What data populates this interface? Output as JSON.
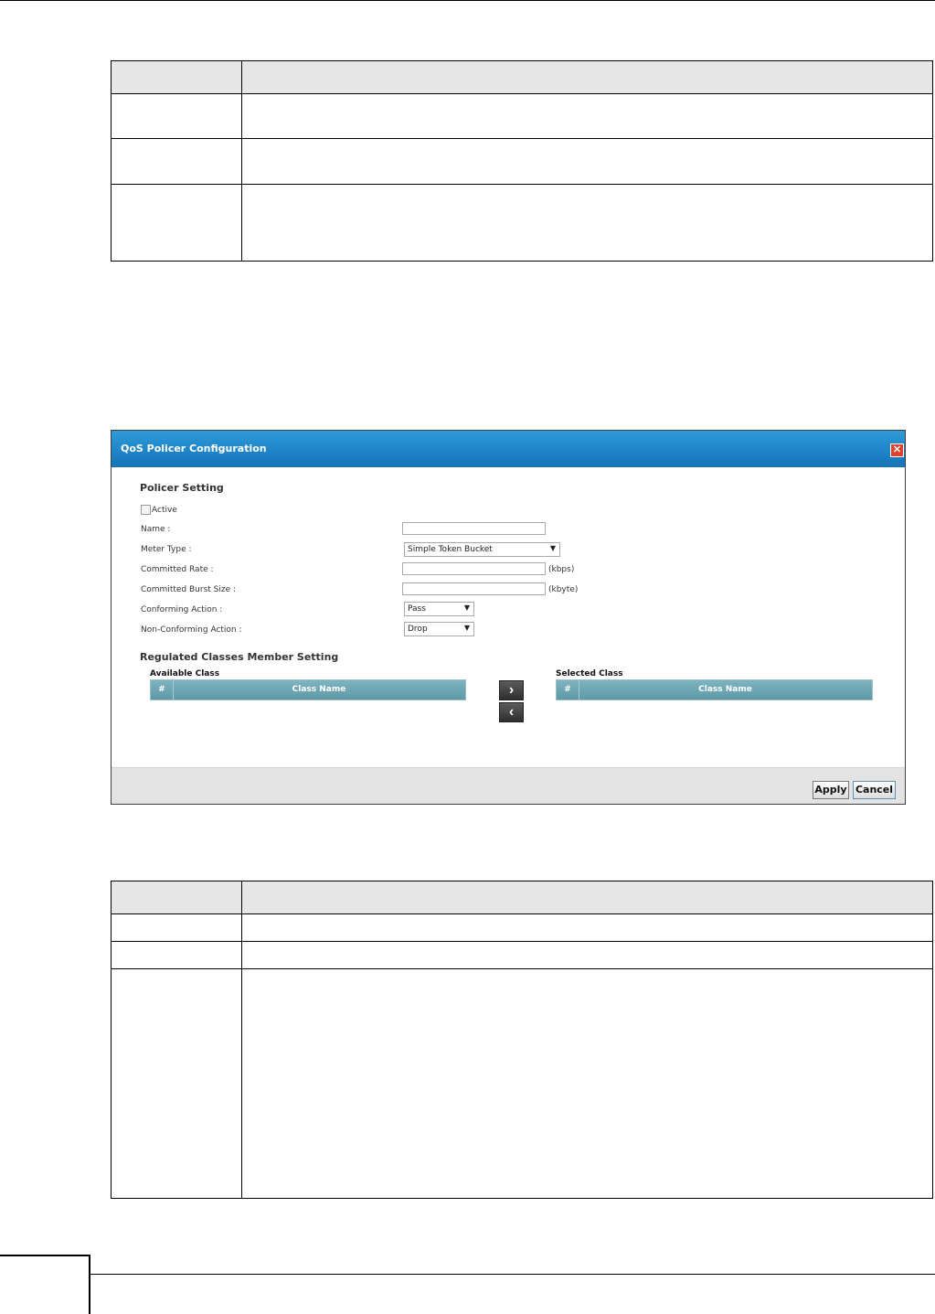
{
  "dialog": {
    "title": "QoS Policer Configuration",
    "close_icon": "close-icon",
    "policer_setting_title": "Policer Setting",
    "active_label": "Active",
    "active_checked": false,
    "name_label": "Name :",
    "name_value": "",
    "meter_type_label": "Meter Type :",
    "meter_type_value": "Simple Token Bucket",
    "committed_rate_label": "Committed Rate :",
    "committed_rate_value": "",
    "committed_rate_unit": "(kbps)",
    "committed_burst_label": "Committed Burst Size :",
    "committed_burst_value": "",
    "committed_burst_unit": "(kbyte)",
    "conforming_label": "Conforming Action :",
    "conforming_value": "Pass",
    "nonconforming_label": "Non-Conforming Action :",
    "nonconforming_value": "Drop",
    "regulated_title": "Regulated Classes Member Setting",
    "available_class_label": "Available Class",
    "selected_class_label": "Selected Class",
    "col_num": "#",
    "col_class_name": "Class Name",
    "move_right_icon": "chevron-right-icon",
    "move_left_icon": "chevron-left-icon",
    "apply_label": "Apply",
    "cancel_label": "Cancel"
  },
  "colors": {
    "header_blue": "#1f86c8",
    "list_header_teal": "#6aa3b1",
    "close_red": "#e2412b"
  }
}
